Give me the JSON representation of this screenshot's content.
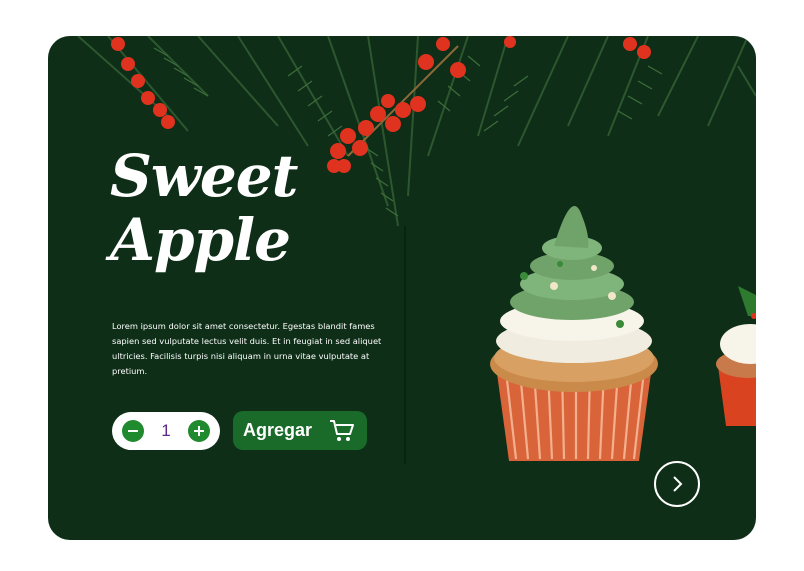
{
  "product": {
    "title_line1": "Sweet",
    "title_line2": "Apple",
    "description": "Lorem ipsum dolor sit amet consectetur. Egestas blandit fames sapien sed vulputate lectus velit duis. Et in feugiat in sed aliquet ultricies. Facilisis turpis nisi aliquam in urna vitae vulputate at pretium."
  },
  "quantity": {
    "value": "1"
  },
  "cart": {
    "add_label": "Agregar"
  },
  "icons": {
    "minus": "minus-icon",
    "plus": "plus-icon",
    "cart": "cart-icon",
    "next": "chevron-right-icon"
  },
  "colors": {
    "card_bg": "#0e2e18",
    "accent_green": "#1f8a2e",
    "button_green": "#1a6b2a",
    "quantity_text": "#5a2a8a"
  }
}
